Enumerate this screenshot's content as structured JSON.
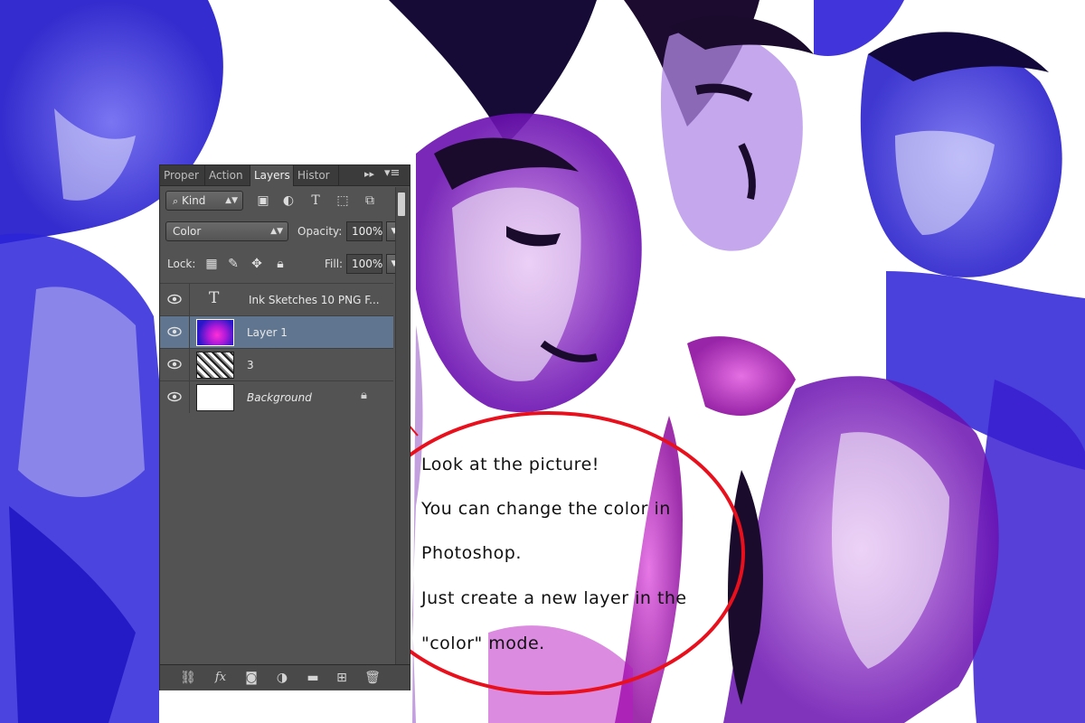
{
  "panel": {
    "tabs": [
      "Proper",
      "Action",
      "Layers",
      "Histor"
    ],
    "active_tab": "Layers",
    "filter": {
      "kind_label": "Kind",
      "icons": [
        "image-filter-icon",
        "adjustment-filter-icon",
        "type-filter-icon",
        "shape-filter-icon",
        "smart-object-filter-icon"
      ]
    },
    "blend_mode": "Color",
    "opacity_label": "Opacity:",
    "opacity_value": "100%",
    "lock_label": "Lock:",
    "fill_label": "Fill:",
    "fill_value": "100%",
    "layers": [
      {
        "name": "Ink Sketches 10 PNG F...",
        "type": "text",
        "visible": true
      },
      {
        "name": "Layer 1",
        "type": "color",
        "visible": true,
        "selected": true
      },
      {
        "name": "3",
        "type": "image",
        "visible": true
      },
      {
        "name": "Background",
        "type": "background",
        "visible": true,
        "locked": true
      }
    ],
    "footer_icons": [
      "link-icon",
      "fx-icon",
      "mask-icon",
      "adjustment-icon",
      "folder-icon",
      "new-layer-icon",
      "trash-icon"
    ]
  },
  "callout": {
    "lines": [
      "Look at the picture!",
      "You can change the color in",
      "Photoshop.",
      "Just create a new layer in the",
      "\"color\" mode."
    ],
    "ellipse_color": "#e8101c"
  },
  "colors": {
    "blue_ink": "#2a1ed6",
    "purple_ink": "#7a1fc8",
    "magenta_ink": "#c019c8",
    "panel_bg": "#535353",
    "selected_layer": "#5f7590"
  }
}
